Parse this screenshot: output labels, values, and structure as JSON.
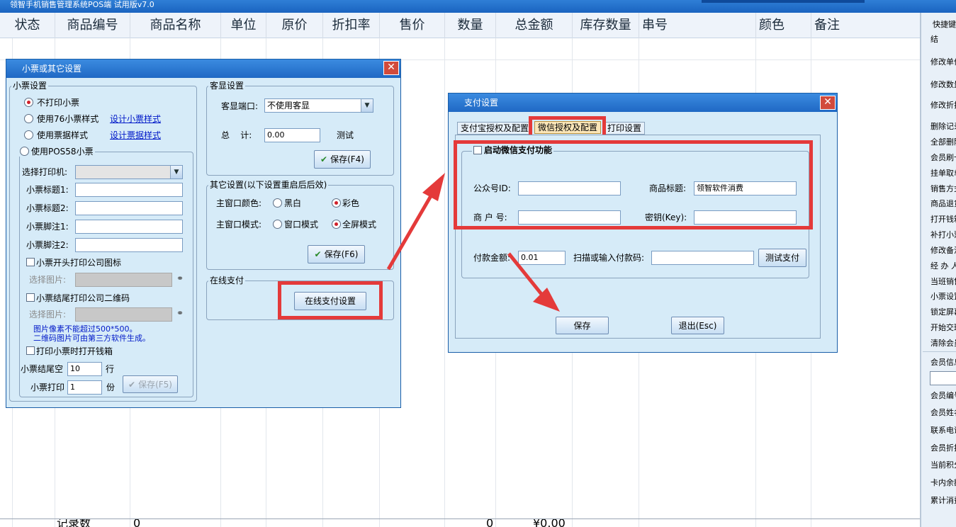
{
  "window_title": "领智手机销售管理系统POS端 试用版v7.0",
  "grid": {
    "columns": [
      "状态",
      "商品编号",
      "商品名称",
      "单位",
      "原价",
      "折扣率",
      "售价",
      "数量",
      "总金额",
      "库存数量",
      "串号",
      "颜色",
      "备注"
    ],
    "footer": {
      "label": "记录数",
      "count": "0",
      "qty_total": "0",
      "amount_total": "¥0.00"
    }
  },
  "right_panel": {
    "items": [
      "快捷键",
      "结",
      "修改单价",
      "修改数量",
      "修改折扣",
      "删除记录",
      "全部删除",
      "会员刷卡",
      "挂单取单",
      "销售方式",
      "商品退货",
      "打开钱箱",
      "补打小票",
      "修改备注",
      "经 办 人",
      "当班销售",
      "小票设置",
      "锁定屏幕",
      "开始交班",
      "清除会员"
    ],
    "member_items": [
      "会员信息",
      "会员编号",
      "会员姓名",
      "联系电话",
      "会员折扣",
      "当前积分",
      "卡内余额",
      "累计消费"
    ]
  },
  "receipt_dialog": {
    "title": "小票或其它设置",
    "receipt_group": "小票设置",
    "opt_no_print": "不打印小票",
    "opt_76": "使用76小票样式",
    "link_design_receipt": "设计小票样式",
    "opt_bill": "使用票据样式",
    "link_design_bill": "设计票据样式",
    "opt_pos58": "使用POS58小票",
    "printer_label": "选择打印机:",
    "title1_label": "小票标题1:",
    "title2_label": "小票标题2:",
    "foot1_label": "小票脚注1:",
    "foot2_label": "小票脚注2:",
    "print_logo": "小票开头打印公司图标",
    "select_image": "选择图片:",
    "print_qr": "小票结尾打印公司二维码",
    "note1": "图片像素不能超过500*500。",
    "note2": "二维码图片可由第三方软件生成。",
    "open_drawer": "打印小票时打开钱箱",
    "tail_blank_label": "小票结尾空",
    "tail_blank_value": "10",
    "tail_blank_unit": "行",
    "copies_label": "小票打印",
    "copies_value": "1",
    "copies_unit": "份",
    "save_f5": "保存(F5)",
    "display_group": "客显设置",
    "display_port_label": "客显端口:",
    "display_port_value": "不使用客显",
    "total_label": "总    计:",
    "total_value": "0.00",
    "test": "测试",
    "save_f4": "保存(F4)",
    "other_group": "其它设置(以下设置重启后后效)",
    "color_label": "主窗口颜色:",
    "color_bw": "黑白",
    "color_color": "彩色",
    "mode_label": "主窗口模式:",
    "mode_window": "窗口模式",
    "mode_full": "全屏模式",
    "save_f6": "保存(F6)",
    "online_group": "在线支付",
    "online_btn": "在线支付设置"
  },
  "payment_dialog": {
    "title": "支付设置",
    "tabs": [
      "支付宝授权及配置",
      "微信授权及配置",
      "打印设置"
    ],
    "enable_wechat": "启动微信支付功能",
    "appid_label": "公众号ID:",
    "appid_value": "",
    "product_title_label": "商品标题:",
    "product_title_value": "领智软件消费",
    "merchant_label": "商 户 号:",
    "merchant_value": "",
    "key_label": "密钥(Key):",
    "key_value": "",
    "amount_label": "付款金额:",
    "amount_value": "0.01",
    "scan_label": "扫描或输入付款码:",
    "scan_value": "",
    "test_pay": "测试支付",
    "save": "保存",
    "exit": "退出(Esc)"
  },
  "colors": {
    "highlight": "#e43a3a",
    "titlebar": "#1f68c4",
    "dialog_bg": "#d6ebf8"
  }
}
